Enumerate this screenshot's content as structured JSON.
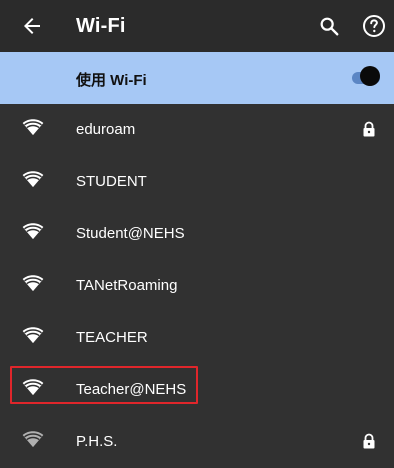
{
  "header": {
    "title": "Wi-Fi",
    "back_icon": "arrow-left-icon",
    "search_icon": "search-icon",
    "help_icon": "help-circle-icon"
  },
  "toggle": {
    "label": "使用 Wi-Fi",
    "state": "on",
    "accent_color": "#a6c8f5"
  },
  "networks": [
    {
      "name": "eduroam",
      "locked": true
    },
    {
      "name": "STUDENT",
      "locked": false
    },
    {
      "name": "Student@NEHS",
      "locked": false
    },
    {
      "name": "TANetRoaming",
      "locked": false
    },
    {
      "name": "TEACHER",
      "locked": false
    },
    {
      "name": "Teacher@NEHS",
      "locked": false,
      "highlighted": true
    },
    {
      "name": "P.H.S.",
      "locked": true
    }
  ],
  "colors": {
    "background": "#313131",
    "highlight_border": "#e0262b"
  }
}
